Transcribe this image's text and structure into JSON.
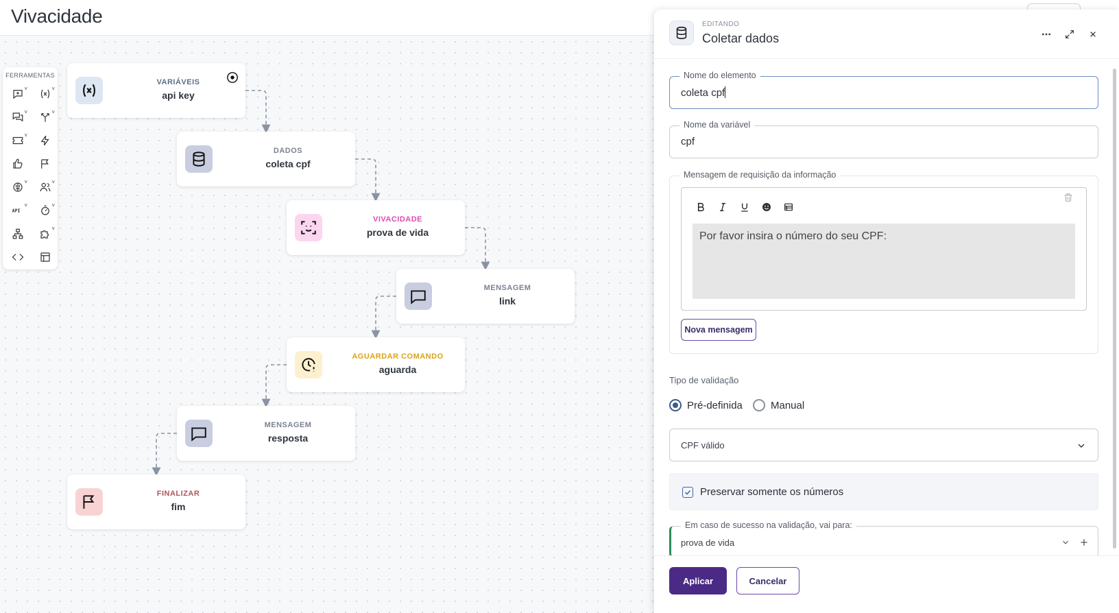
{
  "header": {
    "title": "Vivacidade"
  },
  "toolbox": {
    "title": "FERRAMENTAS",
    "tools": [
      {
        "name": "message-add-tool-icon",
        "has_menu": true
      },
      {
        "name": "variable-tool-icon",
        "has_menu": true
      },
      {
        "name": "chat-tool-icon",
        "has_menu": true
      },
      {
        "name": "branch-tool-icon",
        "has_menu": true
      },
      {
        "name": "ticket-tool-icon",
        "has_menu": true
      },
      {
        "name": "lightning-tool-icon",
        "has_menu": false
      },
      {
        "name": "thumbs-up-tool-icon",
        "has_menu": false
      },
      {
        "name": "flag-tool-icon",
        "has_menu": false
      },
      {
        "name": "brain-tool-icon",
        "has_menu": true
      },
      {
        "name": "users-tool-icon",
        "has_menu": true
      },
      {
        "name": "api-tool-icon",
        "has_menu": true
      },
      {
        "name": "timer-tool-icon",
        "has_menu": true
      },
      {
        "name": "sitemap-tool-icon",
        "has_menu": false
      },
      {
        "name": "puzzle-tool-icon",
        "has_menu": true
      },
      {
        "name": "code-tool-icon",
        "has_menu": false
      },
      {
        "name": "table-tool-icon",
        "has_menu": false
      }
    ]
  },
  "flow": {
    "nodes": [
      {
        "type": "VARIÁVEIS",
        "name": "api key",
        "icon": "variable-icon",
        "type_color": "#5b6f86",
        "icon_bg": "#dde7f3",
        "start": true
      },
      {
        "type": "DADOS",
        "name": "coleta cpf",
        "icon": "database-icon",
        "type_color": "#7b8192",
        "icon_bg": "#c9cde0"
      },
      {
        "type": "VIVACIDADE",
        "name": "prova de vida",
        "icon": "face-scan-icon",
        "type_color": "#e04ab4",
        "icon_bg": "#fbd6ee"
      },
      {
        "type": "MENSAGEM",
        "name": "link",
        "icon": "chat-bubble-icon",
        "type_color": "#7b8192",
        "icon_bg": "#c9cde0"
      },
      {
        "type": "AGUARDAR COMANDO",
        "name": "aguarda",
        "icon": "clock-alert-icon",
        "type_color": "#d9a21b",
        "icon_bg": "#fdf0cf"
      },
      {
        "type": "MENSAGEM",
        "name": "resposta",
        "icon": "chat-bubble-icon",
        "type_color": "#7b8192",
        "icon_bg": "#c9cde0"
      },
      {
        "type": "FINALIZAR",
        "name": "fim",
        "icon": "flag-icon",
        "type_color": "#b0555a",
        "icon_bg": "#f8d3d3"
      }
    ]
  },
  "panel": {
    "subtitle": "EDITANDO",
    "title": "Coletar dados",
    "element_name": {
      "label": "Nome do elemento",
      "value": "coleta cpf"
    },
    "variable_name": {
      "label": "Nome da variável",
      "value": "cpf"
    },
    "request_message": {
      "label": "Mensagem de requisição da informação",
      "text": "Por favor insira o número do seu CPF:",
      "new_message_label": "Nova mensagem"
    },
    "validation": {
      "label": "Tipo de validação",
      "options": [
        {
          "label": "Pré-definida",
          "selected": true
        },
        {
          "label": "Manual",
          "selected": false
        }
      ],
      "selected_rule": "CPF válido"
    },
    "preserve_numbers": {
      "label": "Preservar somente os números",
      "checked": true
    },
    "on_success": {
      "label": "Em caso de sucesso na validação, vai para:",
      "value": "prova de vida"
    },
    "apply_label": "Aplicar",
    "cancel_label": "Cancelar"
  }
}
